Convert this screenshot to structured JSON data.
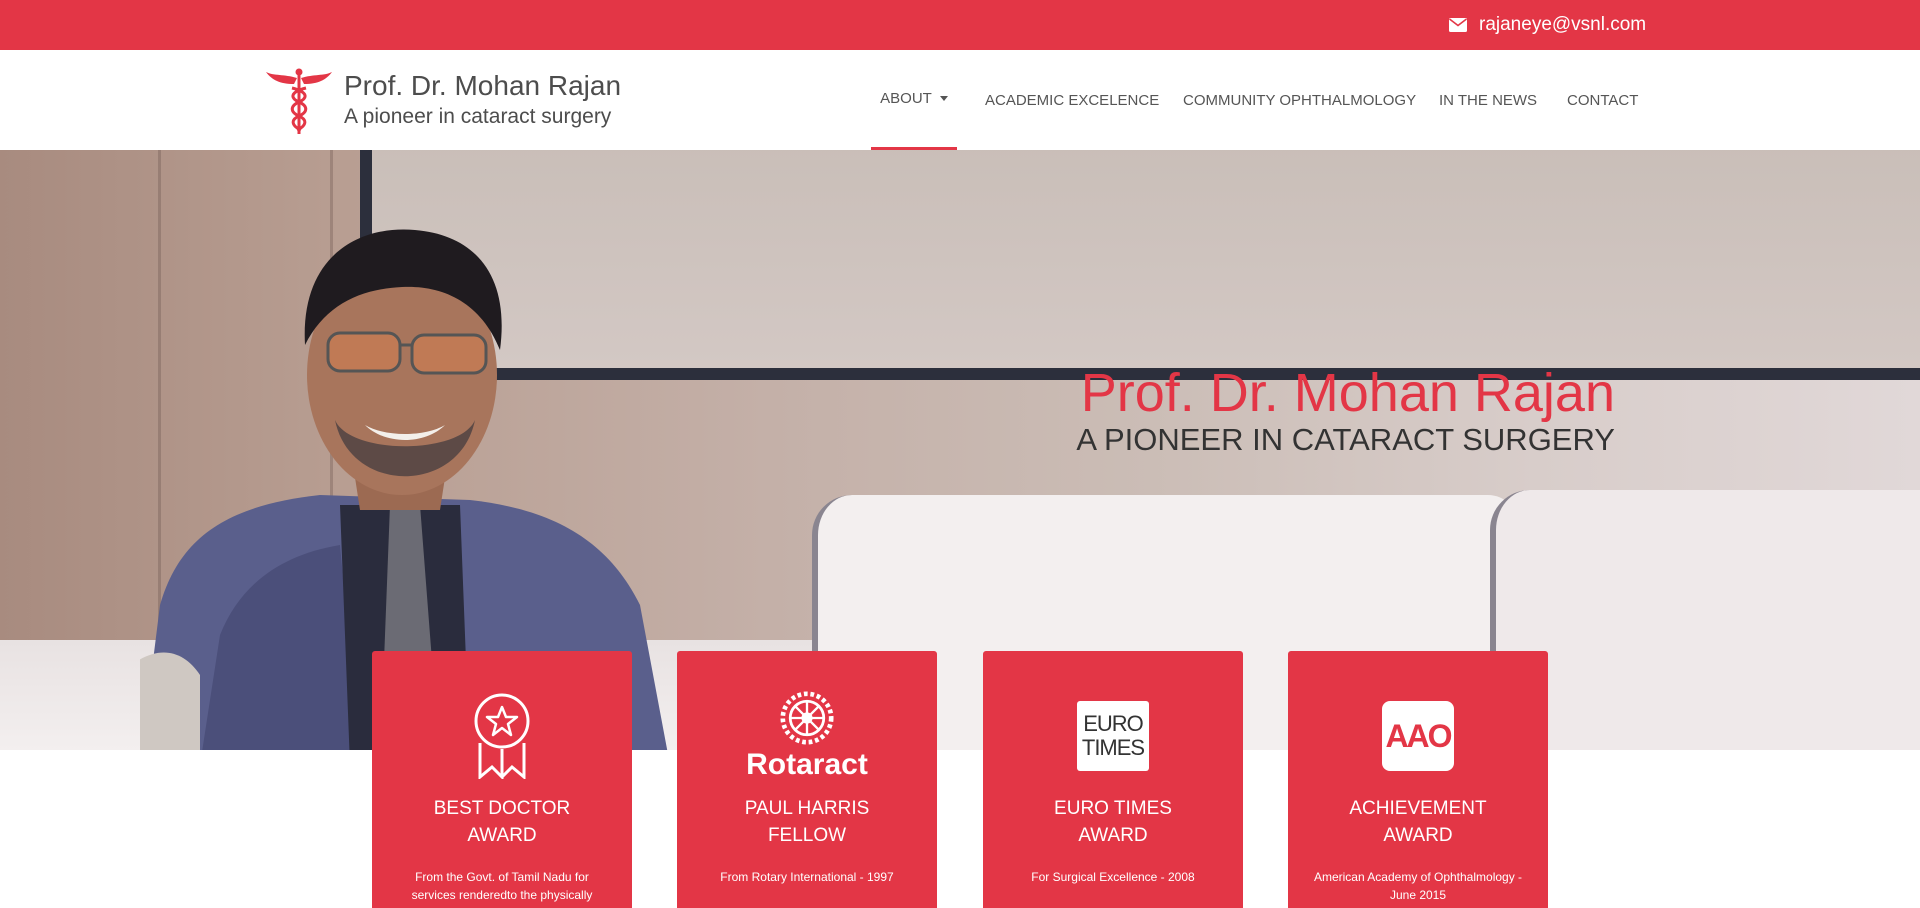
{
  "topbar": {
    "email": "rajaneye@vsnl.com"
  },
  "brand": {
    "name": "Prof. Dr. Mohan Rajan",
    "tagline": "A pioneer in cataract surgery"
  },
  "nav": {
    "items": [
      {
        "label": "ABOUT",
        "active": true,
        "has_dropdown": true
      },
      {
        "label": "ACADEMIC EXCELENCE"
      },
      {
        "label": "COMMUNITY OPHTHALMOLOGY"
      },
      {
        "label": "IN THE NEWS"
      },
      {
        "label": "CONTACT"
      }
    ]
  },
  "hero": {
    "title": "Prof. Dr. Mohan Rajan",
    "subtitle": "A PIONEER IN CATARACT SURGERY"
  },
  "cards": [
    {
      "icon": "award-ribbon-icon",
      "title_line1": "BEST DOCTOR",
      "title_line2": "AWARD",
      "desc": "From the Govt. of Tamil Nadu for services renderedto the physically"
    },
    {
      "icon": "rotaract-logo",
      "logo_text": "Rotaract",
      "title_line1": "PAUL HARRIS",
      "title_line2": "FELLOW",
      "desc": "From Rotary International - 1997"
    },
    {
      "icon": "eurotimes-logo",
      "logo_line1": "EURO",
      "logo_line2": "TIMES",
      "title_line1": "EURO TIMES",
      "title_line2": "AWARD",
      "desc": "For Surgical Excellence - 2008"
    },
    {
      "icon": "aao-logo",
      "logo_text": "AAO",
      "title_line1": "ACHIEVEMENT",
      "title_line2": "AWARD",
      "desc": "American Academy of Ophthalmology - June 2015"
    }
  ],
  "colors": {
    "accent": "#e33646",
    "text": "#4d4d4d"
  }
}
